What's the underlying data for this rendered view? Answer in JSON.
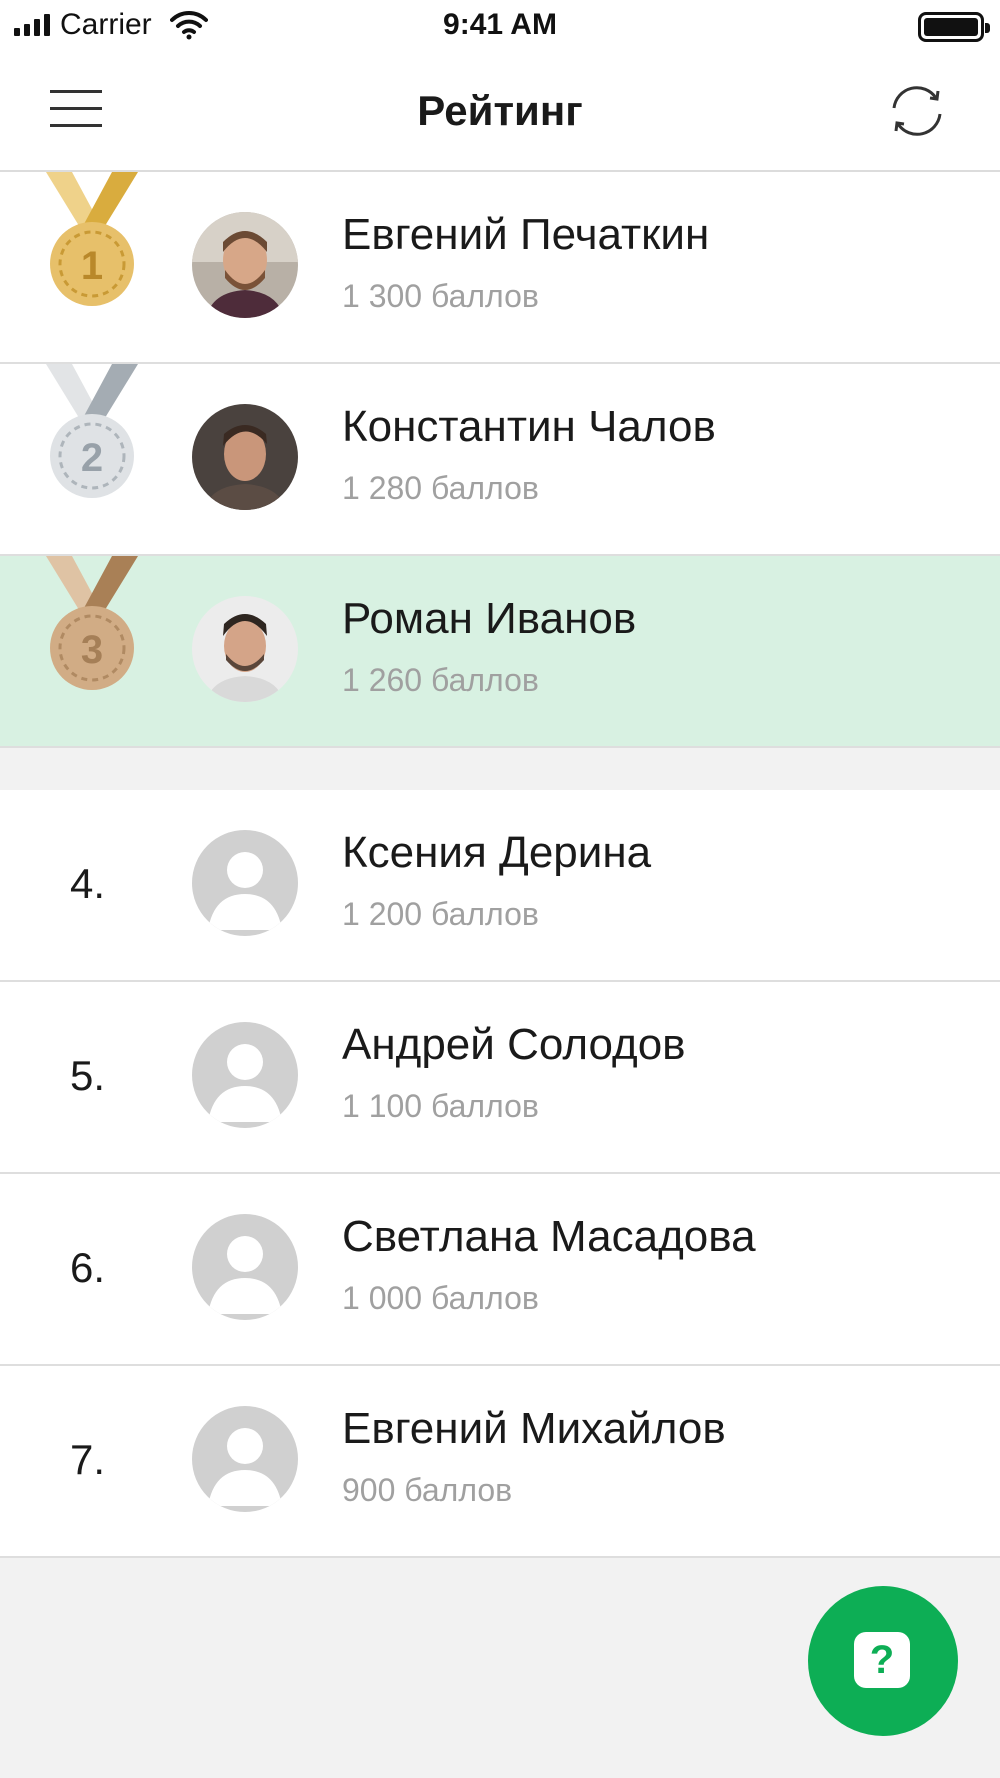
{
  "status_bar": {
    "carrier": "Carrier",
    "time": "9:41 AM"
  },
  "header": {
    "title": "Рейтинг",
    "menu_icon": "hamburger-menu-icon",
    "refresh_icon": "refresh-icon"
  },
  "colors": {
    "highlight": "#d8f1e2",
    "accent": "#0dae55",
    "gold": "#e7c06a",
    "silver": "#c8ccd0",
    "bronze": "#d1ac85"
  },
  "top_ranked": [
    {
      "medal": "1",
      "name": "Евгений Печаткин",
      "score": "1 300 баллов"
    },
    {
      "medal": "2",
      "name": "Константин Чалов",
      "score": "1 280 баллов"
    },
    {
      "medal": "3",
      "name": "Роман Иванов",
      "score": "1 260 баллов"
    }
  ],
  "others": [
    {
      "rank": "4.",
      "name": "Ксения Дерина",
      "score": "1 200 баллов"
    },
    {
      "rank": "5.",
      "name": "Андрей Солодов",
      "score": "1 100 баллов"
    },
    {
      "rank": "6.",
      "name": "Светлана Масадова",
      "score": "1 000 баллов"
    },
    {
      "rank": "7.",
      "name": "Евгений Михайлов",
      "score": "900 баллов"
    }
  ],
  "help_button": {
    "label": "?"
  }
}
